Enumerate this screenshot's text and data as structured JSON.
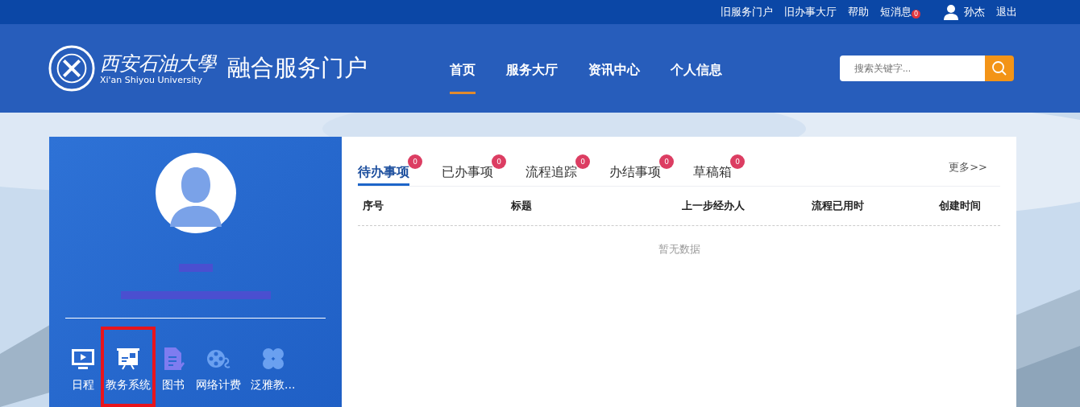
{
  "top_links": [
    {
      "label": "旧服务门户"
    },
    {
      "label": "旧办事大厅"
    },
    {
      "label": "帮助"
    },
    {
      "label": "短消息",
      "badge": "0"
    }
  ],
  "user": {
    "name": "孙杰",
    "logout": "退出"
  },
  "logo": {
    "calligraphy": "西安石油大學",
    "english": "Xi'an Shiyou University"
  },
  "portal_title": "融合服务门户",
  "nav": [
    {
      "label": "首页",
      "selected": true
    },
    {
      "label": "服务大厅",
      "selected": false
    },
    {
      "label": "资讯中心",
      "selected": false
    },
    {
      "label": "个人信息",
      "selected": false
    }
  ],
  "search": {
    "placeholder": "搜索关键字..."
  },
  "apps": [
    {
      "label": "日程",
      "kind": "screen",
      "highlighted": false
    },
    {
      "label": "教务系统",
      "kind": "board",
      "highlighted": true
    },
    {
      "label": "图书",
      "kind": "doc",
      "highlighted": false
    },
    {
      "label": "网络计费",
      "kind": "reel",
      "highlighted": false
    },
    {
      "label": "泛雅教...",
      "kind": "clover",
      "highlighted": false
    }
  ],
  "tabs": [
    {
      "label": "待办事项",
      "badge": "0",
      "selected": true
    },
    {
      "label": "已办事项",
      "badge": "0",
      "selected": false
    },
    {
      "label": "流程追踪",
      "badge": "0",
      "selected": false
    },
    {
      "label": "办结事项",
      "badge": "0",
      "selected": false
    },
    {
      "label": "草稿箱",
      "badge": "0",
      "selected": false
    }
  ],
  "more": "更多>>",
  "table": {
    "columns": [
      "序号",
      "标题",
      "上一步经办人",
      "流程已用时",
      "创建时间"
    ],
    "empty": "暂无数据"
  }
}
